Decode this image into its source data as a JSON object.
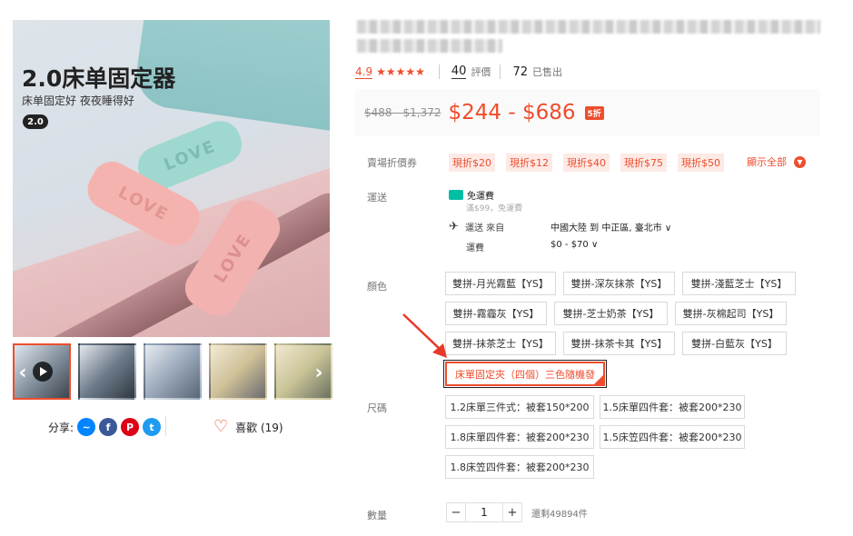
{
  "product": {
    "title_blurred": true,
    "image": {
      "headline": "2.0床单固定器",
      "subline": "床单固定好 夜夜睡得好",
      "badge": "2.0",
      "clip_text": "LOVE"
    },
    "rating": "4.9",
    "stars": "★★★★★",
    "reviews_count": "40",
    "reviews_label": "評價",
    "sold_count": "72",
    "sold_label": "已售出",
    "price_original": "$488 - $1,372",
    "price_current": "$244 - $686",
    "discount_badge": "5折"
  },
  "share": {
    "label": "分享:",
    "like_label": "喜歡 (19)"
  },
  "coupons": {
    "label": "賣場折價券",
    "items": [
      "現折$20",
      "現折$12",
      "現折$40",
      "現折$75",
      "現折$50"
    ],
    "show_all": "顯示全部"
  },
  "shipping": {
    "label": "運送",
    "free": "免運費",
    "free_min": "滿$99，免運費",
    "from_label": "運送 來自",
    "from_value": "中國大陸 到 中正區, 臺北市",
    "fee_label": "運費",
    "fee_value": "$0 - $70"
  },
  "color": {
    "label": "顏色",
    "options": [
      "雙拼-月光霧藍【YS】",
      "雙拼-深灰抹茶【YS】",
      "雙拼-淺藍芝士【YS】",
      "雙拼-霧霾灰【YS】",
      "雙拼-芝士奶茶【YS】",
      "雙拼-灰棉起司【YS】",
      "雙拼-抹茶芝士【YS】",
      "雙拼-抹茶卡其【YS】",
      "雙拼-白藍灰【YS】",
      "床單固定夾（四個）三色隨機發"
    ],
    "selected_index": 9
  },
  "size": {
    "label": "尺碼",
    "options": [
      "1.2床單三件式：被套150*200",
      "1.5床單四件套：被套200*230",
      "1.8床單四件套：被套200*230",
      "1.5床笠四件套：被套200*230",
      "1.8床笠四件套：被套200*230"
    ]
  },
  "quantity": {
    "label": "數量",
    "value": "1",
    "minus": "−",
    "plus": "+",
    "stock": "還剩49894件"
  },
  "colors": {
    "accent": "#ee4d2d"
  }
}
